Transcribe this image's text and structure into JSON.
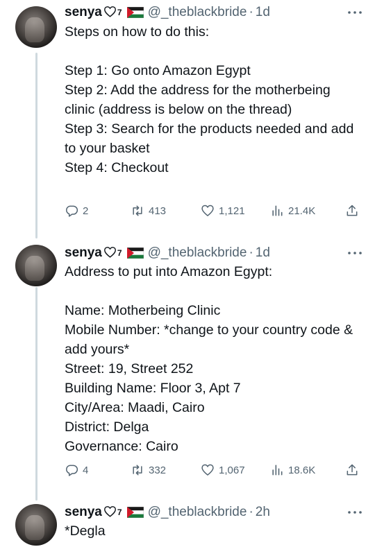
{
  "tweets": [
    {
      "name": "senya",
      "sup": "7",
      "handle": "@_theblackbride",
      "time": "1d",
      "text": "Steps on how to do this:\n\nStep 1: Go onto Amazon Egypt\nStep 2: Add the address for the motherbeing clinic (address is below on the thread)\nStep 3: Search for the products needed and add to your basket\nStep 4: Checkout",
      "replies": "2",
      "retweets": "413",
      "likes": "1,121",
      "views": "21.4K"
    },
    {
      "name": "senya",
      "sup": "7",
      "handle": "@_theblackbride",
      "time": "1d",
      "text": "Address to put into Amazon Egypt:\n\nName: Motherbeing Clinic\nMobile Number: *change to your country code & add yours*\nStreet: 19, Street 252\nBuilding Name: Floor 3, Apt 7\nCity/Area: Maadi, Cairo\nDistrict: Delga\nGovernance: Cairo",
      "replies": "4",
      "retweets": "332",
      "likes": "1,067",
      "views": "18.6K"
    },
    {
      "name": "senya",
      "sup": "7",
      "handle": "@_theblackbride",
      "time": "2h",
      "text": "*Degla"
    }
  ],
  "colors": {
    "text": "#0f1419",
    "muted": "#536471",
    "thread": "#cfd9de"
  },
  "icons": [
    "heart-outline-icon",
    "palestine-flag-icon",
    "more-icon",
    "reply-icon",
    "retweet-icon",
    "like-icon",
    "views-icon",
    "share-icon"
  ]
}
